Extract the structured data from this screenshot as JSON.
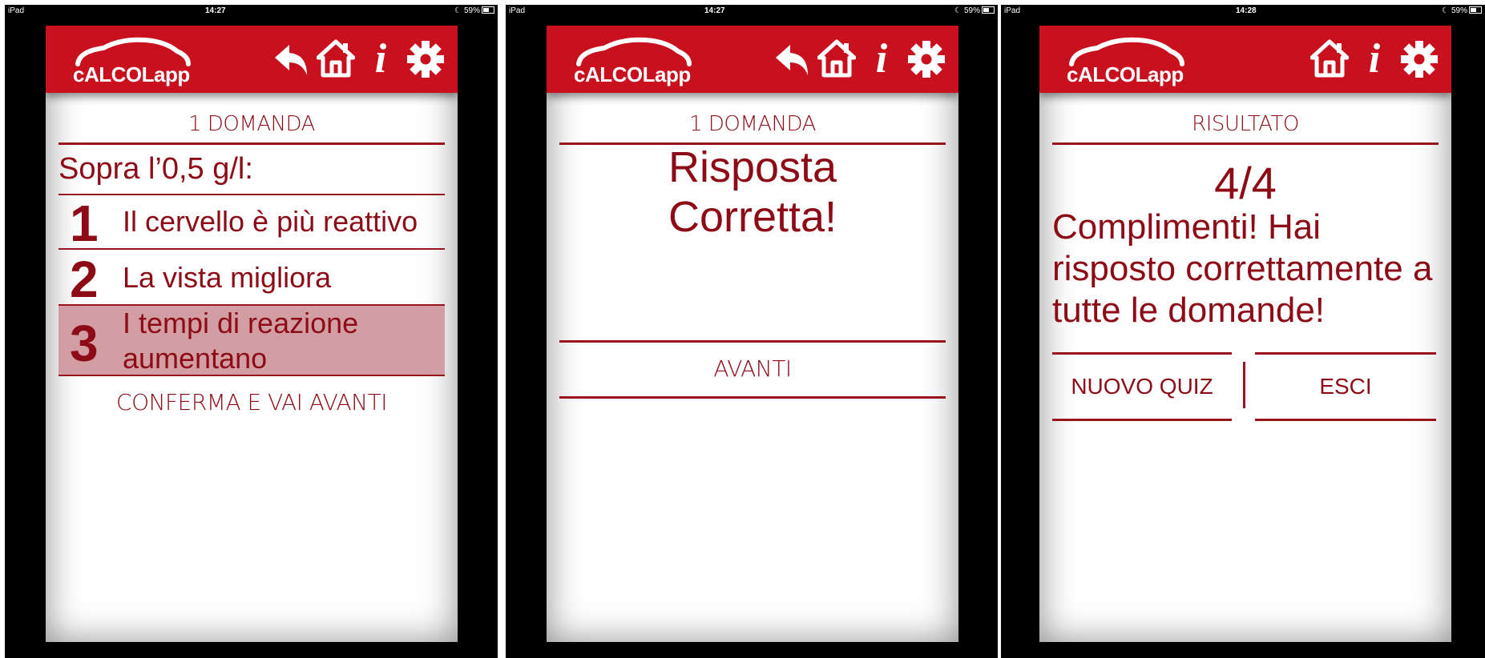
{
  "status_bar": {
    "carrier": "iPad",
    "screen1_time": "14:27",
    "screen2_time": "14:27",
    "screen3_time": "14:28",
    "battery": "59%"
  },
  "app": {
    "logo_text": "cALCOLapp",
    "accent_color": "#c8101e",
    "text_color": "#8d0b16",
    "icons": [
      "back-arrow-icon",
      "home-icon",
      "info-icon",
      "gear-icon"
    ]
  },
  "screen_question": {
    "title": "1 DOMANDA",
    "question": "Sopra l’0,5 g/l:",
    "answers": [
      {
        "number": "1",
        "text": "Il cervello è più reattivo",
        "selected": false
      },
      {
        "number": "2",
        "text": "La vista migliora",
        "selected": false
      },
      {
        "number": "3",
        "text": "I tempi di reazione aumentano",
        "selected": true
      }
    ],
    "confirm_label": "CONFERMA E VAI AVANTI"
  },
  "screen_feedback": {
    "title": "1 DOMANDA",
    "message_line1": "Risposta",
    "message_line2": "Corretta!",
    "next_label": "AVANTI"
  },
  "screen_result": {
    "title": "RISULTATO",
    "score": "4/4",
    "message": "Complimenti! Hai risposto correttamente a tutte le domande!",
    "new_quiz_label": "NUOVO QUIZ",
    "exit_label": "ESCI"
  }
}
